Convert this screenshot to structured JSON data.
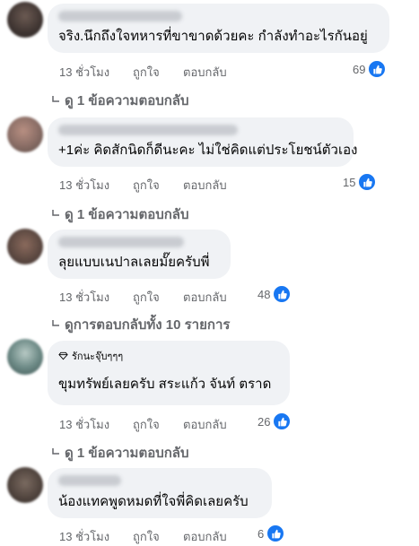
{
  "colors": {
    "accent": "#1877f2",
    "bubble": "#f0f2f5",
    "meta": "#65676b"
  },
  "comments": [
    {
      "text": "จริง.นึกถึงใจทหารที่ขาขาดด้วยคะ กำลังทำอะไรกันอยู่",
      "time": "13 ชั่วโมง",
      "like": "ถูกใจ",
      "reply": "ตอบกลับ",
      "reactions": "69",
      "view_replies": "ดู 1 ข้อความตอบกลับ"
    },
    {
      "text": "+1ค่ะ คิดสักนิดก็ดีนะคะ ไม่ใช่คิดแต่ประโยชน์ตัวเอง",
      "time": "13 ชั่วโมง",
      "like": "ถูกใจ",
      "reply": "ตอบกลับ",
      "reactions": "15",
      "view_replies": "ดู 1 ข้อความตอบกลับ"
    },
    {
      "text": "ลุยแบบเนปาลเลยมั๊ยครับพี่",
      "time": "13 ชั่วโมง",
      "like": "ถูกใจ",
      "reply": "ตอบกลับ",
      "reactions": "48",
      "view_replies": "ดูการตอบกลับทั้ง 10 รายการ"
    },
    {
      "badge": "รักนะจุ๊บๆๆๆ",
      "text": "ขุมทรัพย์เลยครับ สระแก้ว จันท์ ตราด",
      "time": "13 ชั่วโมง",
      "like": "ถูกใจ",
      "reply": "ตอบกลับ",
      "reactions": "26",
      "view_replies": "ดู 1 ข้อความตอบกลับ"
    },
    {
      "text": "น้องแทคพูดหมดที่ใจพี่คิดเลยครับ",
      "time": "13 ชั่วโมง",
      "like": "ถูกใจ",
      "reply": "ตอบกลับ",
      "reactions": "6"
    }
  ]
}
